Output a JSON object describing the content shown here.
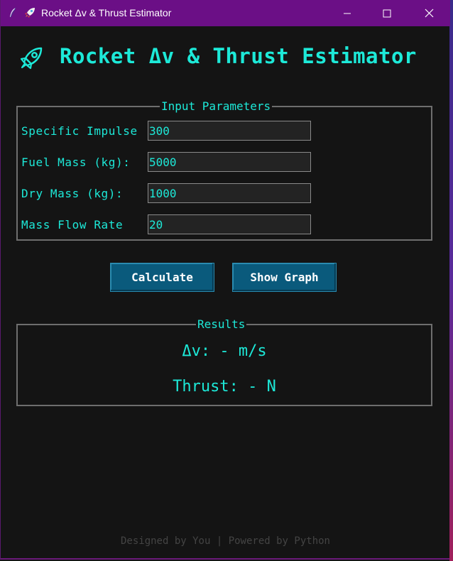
{
  "window": {
    "title": "Rocket Δv & Thrust Estimator",
    "titlebar_color": "#6b0f86",
    "icons": [
      "feather-icon",
      "rocket-icon"
    ]
  },
  "heading": {
    "text": "Rocket Δv & Thrust Estimator",
    "icon": "rocket-icon"
  },
  "inputs": {
    "legend": "Input Parameters",
    "fields": [
      {
        "label": "Specific Impulse",
        "value": "300"
      },
      {
        "label": "Fuel Mass (kg):",
        "value": "5000"
      },
      {
        "label": "Dry Mass (kg):",
        "value": "1000"
      },
      {
        "label": "Mass Flow Rate",
        "value": "20"
      }
    ]
  },
  "buttons": {
    "calculate": "Calculate",
    "show_graph": "Show Graph"
  },
  "results": {
    "legend": "Results",
    "delta_v": "Δv: - m/s",
    "thrust": "Thrust: - N"
  },
  "footer": "Designed by You | Powered by Python",
  "colors": {
    "accent": "#1de9d8",
    "background": "#141414",
    "button": "#0a5a7c",
    "footer_text": "#444444"
  }
}
